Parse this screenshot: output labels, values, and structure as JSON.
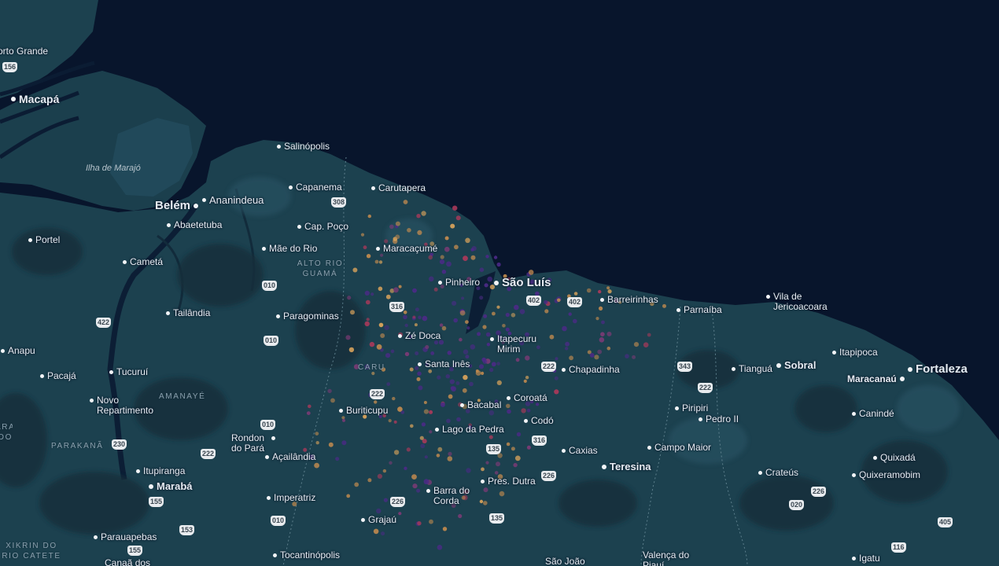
{
  "map": {
    "colors": {
      "ocean": "#08152c",
      "land": "#1c414f",
      "land_dark": "#132d3a",
      "river": "#0c1e35",
      "heat_low": "#c08a4f",
      "heat_mid": "#a9395a",
      "heat_high": "#4b2a86"
    },
    "places": [
      {
        "name": "orto Grande",
        "type": "town"
      },
      {
        "name": "Macapá",
        "type": "city"
      },
      {
        "name": "Salinópolis",
        "type": "town"
      },
      {
        "name": "Capanema",
        "type": "town"
      },
      {
        "name": "Carutapera",
        "type": "town"
      },
      {
        "name": "Belém",
        "type": "big"
      },
      {
        "name": "Ananindeua",
        "type": "city"
      },
      {
        "name": "Abaetetuba",
        "type": "town"
      },
      {
        "name": "Cap. Poço",
        "type": "town"
      },
      {
        "name": "Portel",
        "type": "town"
      },
      {
        "name": "Mãe do Rio",
        "type": "town"
      },
      {
        "name": "Maracaçumé",
        "type": "town"
      },
      {
        "name": "Cametá",
        "type": "town"
      },
      {
        "name": "Pinheiro",
        "type": "town"
      },
      {
        "name": "São Luís",
        "type": "big"
      },
      {
        "name": "Barreirinhas",
        "type": "town"
      },
      {
        "name": "Parnaíba",
        "type": "town"
      },
      {
        "name": "Vila de Jericoacoara",
        "type": "town"
      },
      {
        "name": "Tailândia",
        "type": "town"
      },
      {
        "name": "Paragominas",
        "type": "town"
      },
      {
        "name": "Zé Doca",
        "type": "town"
      },
      {
        "name": "Itapecuru Mirim",
        "type": "town"
      },
      {
        "name": "Anapu",
        "type": "town"
      },
      {
        "name": "Itapipoca",
        "type": "town"
      },
      {
        "name": "Santa Inês",
        "type": "town"
      },
      {
        "name": "Chapadinha",
        "type": "town"
      },
      {
        "name": "Tianguá",
        "type": "town"
      },
      {
        "name": "Sobral",
        "type": "city"
      },
      {
        "name": "Fortaleza",
        "type": "big"
      },
      {
        "name": "Pacajá",
        "type": "town"
      },
      {
        "name": "Tucuruí",
        "type": "town"
      },
      {
        "name": "Maracanaú",
        "type": "city"
      },
      {
        "name": "Novo Repartimento",
        "type": "town"
      },
      {
        "name": "Buriticupu",
        "type": "town"
      },
      {
        "name": "Bacabal",
        "type": "town"
      },
      {
        "name": "Coroatá",
        "type": "town"
      },
      {
        "name": "Piripiri",
        "type": "town"
      },
      {
        "name": "Pedro II",
        "type": "town"
      },
      {
        "name": "Canindé",
        "type": "town"
      },
      {
        "name": "Lago da Pedra",
        "type": "town"
      },
      {
        "name": "Codó",
        "type": "town"
      },
      {
        "name": "Rondon do Pará",
        "type": "town"
      },
      {
        "name": "Caxias",
        "type": "town"
      },
      {
        "name": "Campo Maior",
        "type": "town"
      },
      {
        "name": "Açailândia",
        "type": "town"
      },
      {
        "name": "Quixadá",
        "type": "town"
      },
      {
        "name": "Itupiranga",
        "type": "town"
      },
      {
        "name": "Teresina",
        "type": "city"
      },
      {
        "name": "Crateús",
        "type": "town"
      },
      {
        "name": "Quixeramobim",
        "type": "town"
      },
      {
        "name": "Pres. Dutra",
        "type": "town"
      },
      {
        "name": "Marabá",
        "type": "city"
      },
      {
        "name": "Imperatriz",
        "type": "town"
      },
      {
        "name": "Barra do Corda",
        "type": "town"
      },
      {
        "name": "Grajaú",
        "type": "town"
      },
      {
        "name": "Parauapebas",
        "type": "town"
      },
      {
        "name": "Tocantinópolis",
        "type": "town"
      },
      {
        "name": "Igatu",
        "type": "town"
      },
      {
        "name": "Canaã dos",
        "type": "town"
      },
      {
        "name": "São João",
        "type": "town"
      },
      {
        "name": "Valença do Piauí",
        "type": "town"
      }
    ],
    "regions": [
      "ALTO RIO GUAMÁ",
      "CARU",
      "AMANAYÉ",
      "PARAKANÃ",
      "XIKRIN DO RIO CATETE",
      "ARA DO"
    ],
    "island": "Ilha de Marajó",
    "shields": [
      "156",
      "308",
      "010",
      "316",
      "402",
      "402",
      "422",
      "010",
      "222",
      "343",
      "222",
      "222",
      "010",
      "230",
      "222",
      "316",
      "135",
      "226",
      "155",
      "153",
      "226",
      "010",
      "135",
      "020",
      "226",
      "405",
      "116",
      "155"
    ]
  }
}
